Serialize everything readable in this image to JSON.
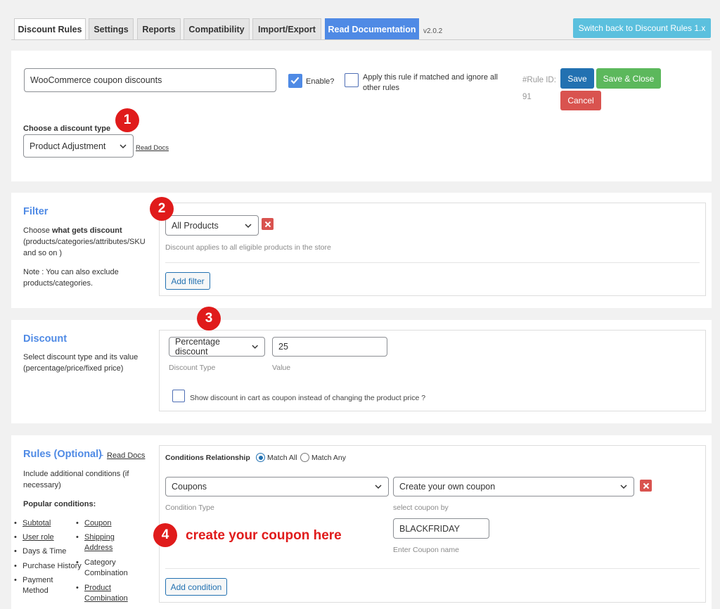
{
  "tabs": [
    {
      "label": "Discount Rules"
    },
    {
      "label": "Settings"
    },
    {
      "label": "Reports"
    },
    {
      "label": "Compatibility"
    },
    {
      "label": "Import/Export"
    },
    {
      "label": "Read Documentation"
    }
  ],
  "version": "v2.0.2",
  "switch_button": "Switch back to Discount Rules 1.x",
  "rule": {
    "name_value": "WooCommerce coupon discounts",
    "enable_label": "Enable?",
    "enable_checked": true,
    "apply_label": "Apply this rule if matched and ignore all other rules",
    "rule_id_label": "#Rule ID:",
    "rule_id_value": "91",
    "save_label": "Save",
    "save_close_label": "Save & Close",
    "cancel_label": "Cancel",
    "discount_type_label": "Choose a discount type",
    "discount_type_value": "Product Adjustment",
    "read_docs": "Read Docs"
  },
  "badges": [
    "1",
    "2",
    "3",
    "4"
  ],
  "filter": {
    "title": "Filter",
    "desc_prefix": "Choose ",
    "desc_bold": "what gets discount",
    "desc_rest": "(products/categories/attributes/SKU and so on )",
    "note": "Note : You can also exclude products/categories.",
    "select_value": "All Products",
    "help": "Discount applies to all eligible products in the store",
    "add_button": "Add filter"
  },
  "discount": {
    "title": "Discount",
    "desc": "Select discount type and its value (percentage/price/fixed price)",
    "type_value": "Percentage discount",
    "value": "25",
    "type_label": "Discount Type",
    "value_label": "Value",
    "coupon_checkbox_label": "Show discount in cart as coupon instead of changing the product price ?"
  },
  "rules": {
    "title": "Rules (Optional)",
    "dash": "-",
    "read_docs": "Read Docs",
    "desc": "Include additional conditions (if necessary)",
    "popular_label": "Popular conditions:",
    "popular_left": [
      "Subtotal",
      "User role",
      "Days & Time",
      "Purchase History",
      "Payment Method"
    ],
    "popular_right": [
      "Coupon",
      "Shipping Address",
      "Category Combination",
      "Product Combination"
    ],
    "relationship_label": "Conditions Relationship",
    "match_all": "Match All",
    "match_any": "Match Any",
    "condition_type_value": "Coupons",
    "coupon_select_value": "Create your own coupon",
    "condition_type_label": "Condition Type",
    "select_coupon_by": "select coupon by",
    "coupon_name_value": "BLACKFRIDAY",
    "coupon_name_label": "Enter Coupon name",
    "add_condition": "Add condition"
  },
  "annotation": "create your coupon here",
  "colors": {
    "accent": "#4f8ae5",
    "save": "#2271b1",
    "save_close": "#5cb85c",
    "cancel": "#d9534f",
    "badge": "#e01b1b",
    "switch": "#5bc0de"
  }
}
